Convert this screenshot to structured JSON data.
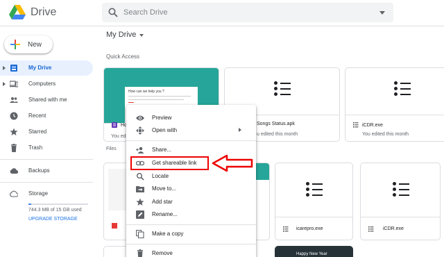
{
  "header": {
    "brand": "Drive",
    "search_placeholder": "Search Drive"
  },
  "sidebar": {
    "new_label": "New",
    "items": [
      {
        "label": "My Drive",
        "icon": "my-drive-icon",
        "active": true
      },
      {
        "label": "Computers",
        "icon": "computers-icon"
      },
      {
        "label": "Shared with me",
        "icon": "shared-icon"
      },
      {
        "label": "Recent",
        "icon": "clock-icon"
      },
      {
        "label": "Starred",
        "icon": "star-icon"
      },
      {
        "label": "Trash",
        "icon": "trash-icon"
      },
      {
        "label": "Backups",
        "icon": "cloud-icon"
      },
      {
        "label": "Storage",
        "icon": "cloud-outline-icon"
      }
    ],
    "storage_used": "744.3 MB of 15 GB used",
    "storage_fraction": 0.05,
    "upgrade_label": "UPGRADE STORAGE"
  },
  "main": {
    "location": "My Drive",
    "quick_access_label": "Quick Access",
    "files_label": "Files",
    "quick_cards": [
      {
        "name": "Ho",
        "sub": "You edi",
        "thumb_text": "How can we help you ?"
      },
      {
        "name": "Songs Status.apk",
        "sub": "u edited this month"
      },
      {
        "name": "iCDR.exe",
        "sub": "You edited this month"
      }
    ],
    "file_cards": [
      {
        "name": ""
      },
      {
        "name": ""
      },
      {
        "name": "icarepro.exe"
      },
      {
        "name": "iCDR.exe"
      }
    ],
    "bottom_card_text": "Happy New Year"
  },
  "context_menu": {
    "items": [
      {
        "label": "Preview",
        "icon": "eye-icon"
      },
      {
        "label": "Open with",
        "icon": "open-with-icon",
        "submenu": true
      },
      {
        "label": "Share...",
        "icon": "share-person-icon"
      },
      {
        "label": "Get shareable link",
        "icon": "link-icon",
        "highlighted": true
      },
      {
        "label": "Locate",
        "icon": "search-icon"
      },
      {
        "label": "Move to...",
        "icon": "move-folder-icon"
      },
      {
        "label": "Add star",
        "icon": "star-icon"
      },
      {
        "label": "Rename...",
        "icon": "rename-icon"
      },
      {
        "label": "Make a copy",
        "icon": "copy-icon"
      },
      {
        "label": "Remove",
        "icon": "trash-icon"
      }
    ]
  },
  "colors": {
    "accent": "#1a73e8",
    "active_bg": "#e8f0fe",
    "highlight_red": "#e00000",
    "quick_card_teal": "#26a69a"
  }
}
